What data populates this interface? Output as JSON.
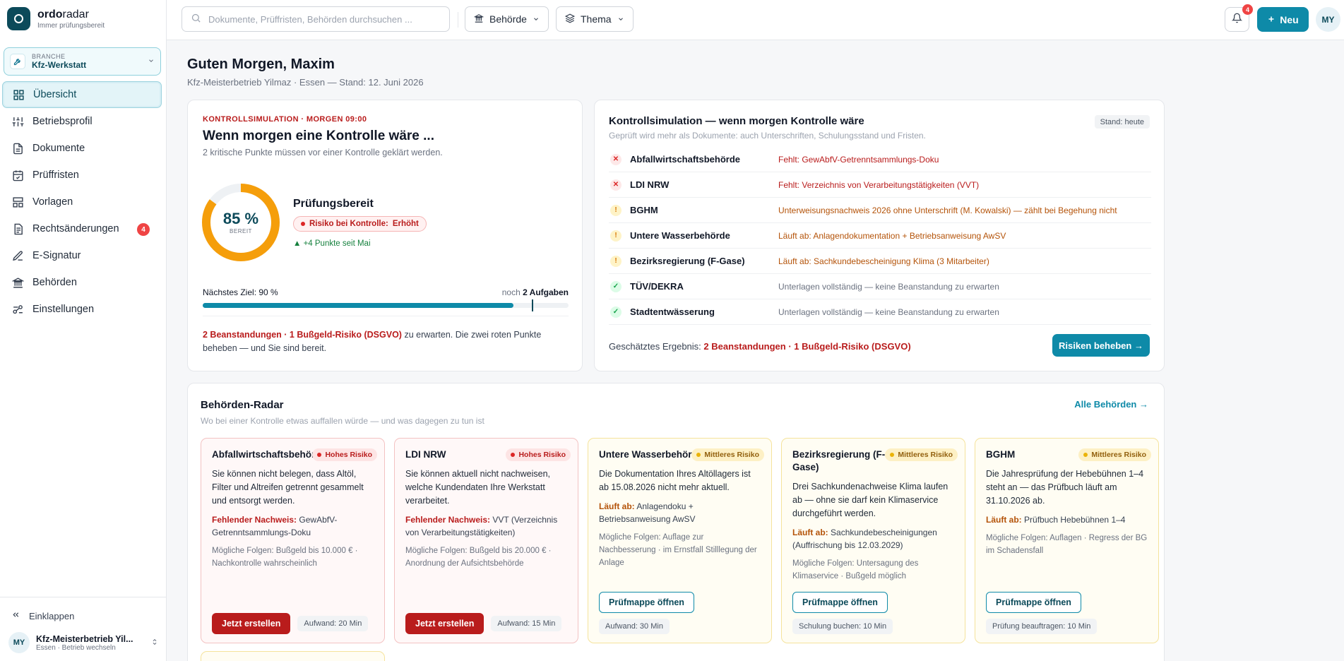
{
  "app": {
    "name_a": "ordo",
    "name_b": "radar",
    "tagline": "Immer prüfungsbereit"
  },
  "branch": {
    "label": "BRANCHE",
    "value": "Kfz-Werkstatt"
  },
  "nav": [
    {
      "label": "Übersicht",
      "icon": "grid-icon"
    },
    {
      "label": "Betriebsprofil",
      "icon": "sliders-icon"
    },
    {
      "label": "Dokumente",
      "icon": "document-icon"
    },
    {
      "label": "Prüffristen",
      "icon": "calendar-icon"
    },
    {
      "label": "Vorlagen",
      "icon": "layout-icon"
    },
    {
      "label": "Rechtsänderungen",
      "icon": "law-icon",
      "badge": "4"
    },
    {
      "label": "E-Signatur",
      "icon": "pen-icon"
    },
    {
      "label": "Behörden",
      "icon": "building-icon"
    },
    {
      "label": "Einstellungen",
      "icon": "settings-icon"
    }
  ],
  "sidebar_bottom": {
    "collapse": "Einklappen",
    "initials": "MY",
    "account_name": "Kfz-Meisterbetrieb Yil...",
    "account_sub": "Essen · Betrieb wechseln"
  },
  "topbar": {
    "search_placeholder": "Dokumente, Prüffristen, Behörden durchsuchen ...",
    "filter_authority": "Behörde",
    "filter_topic": "Thema",
    "notif_count": "4",
    "new_label": "Neu",
    "user_initials": "MY"
  },
  "greeting": {
    "title": "Guten Morgen, Maxim",
    "subtitle": "Kfz-Meisterbetrieb Yilmaz · Essen — Stand: 12. Juni 2026"
  },
  "sim_card": {
    "kicker": "KONTROLLSIMULATION · MORGEN 09:00",
    "title": "Wenn morgen eine Kontrolle wäre ...",
    "subtitle": "2 kritische Punkte müssen vor einer Kontrolle geklärt werden.",
    "score_text": "85 %",
    "score_fraction": 0.85,
    "score_label": "BEREIT",
    "status": "Prüfungsbereit",
    "risk_label": "Risiko bei Kontrolle:",
    "risk_value": "Erhöht",
    "trend": "▲ +4 Punkte seit Mai",
    "goal_label": "Nächstes Ziel: 90 %",
    "goal_prefix": "noch",
    "goal_tasks": "2 Aufgaben",
    "progress_fraction": 0.85,
    "goal_fraction": 0.9,
    "footer_red": "2 Beanstandungen · 1 Bußgeld-Risiko (DSGVO)",
    "footer_rest": " zu erwarten. Die zwei roten Punkte beheben — und Sie sind bereit."
  },
  "sim_list": {
    "title": "Kontrollsimulation — wenn morgen Kontrolle wäre",
    "subtitle": "Geprüft wird mehr als Dokumente: auch Unterschriften, Schulungsstand und Fristen.",
    "stand": "Stand: heute",
    "rows": [
      {
        "status": "x",
        "symbol": "✕",
        "name": "Abfallwirtschaftsbehörde",
        "text": "Fehlt: GewAbfV-Getrenntsammlungs-Doku"
      },
      {
        "status": "x",
        "symbol": "✕",
        "name": "LDI NRW",
        "text": "Fehlt: Verzeichnis von Verarbeitungstätigkeiten (VVT)"
      },
      {
        "status": "w",
        "symbol": "!",
        "name": "BGHM",
        "text": "Unterweisungsnachweis 2026 ohne Unterschrift (M. Kowalski) — zählt bei Begehung nicht"
      },
      {
        "status": "w",
        "symbol": "!",
        "name": "Untere Wasserbehörde",
        "text": "Läuft ab: Anlagendokumentation + Betriebsanweisung AwSV"
      },
      {
        "status": "w",
        "symbol": "!",
        "name": "Bezirksregierung (F-Gase)",
        "text": "Läuft ab: Sachkundebescheinigung Klima (3 Mitarbeiter)"
      },
      {
        "status": "ok",
        "symbol": "✓",
        "name": "TÜV/DEKRA",
        "text": "Unterlagen vollständig — keine Beanstandung zu erwarten"
      },
      {
        "status": "ok",
        "symbol": "✓",
        "name": "Stadtentwässerung",
        "text": "Unterlagen vollständig — keine Beanstandung zu erwarten"
      }
    ],
    "result_label": "Geschätztes Ergebnis:",
    "result_value": "2 Beanstandungen · 1 Bußgeld-Risiko (DSGVO)",
    "fix_button": "Risiken beheben →"
  },
  "radar": {
    "title": "Behörden-Radar",
    "subtitle": "Wo bei einer Kontrolle etwas auffallen würde — und was dagegen zu tun ist",
    "all_link": "Alle Behörden →",
    "cards": [
      {
        "level": "hi",
        "name": "Abfallwirtschaftsbehörde",
        "pill": "Hohes Risiko",
        "desc": "Sie können nicht belegen, dass Altöl, Filter und Altreifen getrennt gesammelt und entsorgt werden.",
        "miss_label": "Fehlender Nachweis:",
        "miss_text": "GewAbfV-Getrenntsammlungs-Doku",
        "cons": "Mögliche Folgen: Bußgeld bis 10.000 € · Nachkontrolle wahrscheinlich",
        "action": "Jetzt erstellen",
        "effort": "Aufwand: 20 Min"
      },
      {
        "level": "hi",
        "name": "LDI NRW",
        "pill": "Hohes Risiko",
        "desc": "Sie können aktuell nicht nachweisen, welche Kundendaten Ihre Werkstatt verarbeitet.",
        "miss_label": "Fehlender Nachweis:",
        "miss_text": "VVT (Verzeichnis von Verarbeitungstätigkeiten)",
        "cons": "Mögliche Folgen: Bußgeld bis 20.000 € · Anordnung der Aufsichtsbehörde",
        "action": "Jetzt erstellen",
        "effort": "Aufwand: 15 Min"
      },
      {
        "level": "mid",
        "name": "Untere Wasserbehörde",
        "pill": "Mittleres Risiko",
        "desc": "Die Dokumentation Ihres Altöllagers ist ab 15.08.2026 nicht mehr aktuell.",
        "miss_label": "Läuft ab:",
        "miss_text": "Anlagendoku + Betriebsanweisung AwSV",
        "cons": "Mögliche Folgen: Auflage zur Nachbesserung · im Ernstfall Stilllegung der Anlage",
        "action": "Prüfmappe öffnen",
        "effort": "Aufwand: 30 Min"
      },
      {
        "level": "mid",
        "name": "Bezirksregierung (F-Gase)",
        "pill": "Mittleres Risiko",
        "desc": "Drei Sachkundenachweise Klima laufen ab — ohne sie darf kein Klimaservice durchgeführt werden.",
        "miss_label": "Läuft ab:",
        "miss_text": "Sachkundebescheinigungen (Auffrischung bis 12.03.2029)",
        "cons": "Mögliche Folgen: Untersagung des Klimaservice · Bußgeld möglich",
        "action": "Prüfmappe öffnen",
        "effort": "Schulung buchen: 10 Min"
      },
      {
        "level": "mid",
        "name": "BGHM",
        "pill": "Mittleres Risiko",
        "desc": "Die Jahresprüfung der Hebebühnen 1–4 steht an — das Prüfbuch läuft am 31.10.2026 ab.",
        "miss_label": "Läuft ab:",
        "miss_text": "Prüfbuch Hebebühnen 1–4",
        "cons": "Mögliche Folgen: Auflagen · Regress der BG im Schadensfall",
        "action": "Prüfmappe öffnen",
        "effort": "Prüfung beauftragen: 10 Min"
      }
    ]
  },
  "colors": {
    "accent": "#0e8aa8",
    "brand_dark": "#0c4a5a",
    "danger": "#b91c1c",
    "warning": "#b45309",
    "ring": "#f59e0b"
  }
}
